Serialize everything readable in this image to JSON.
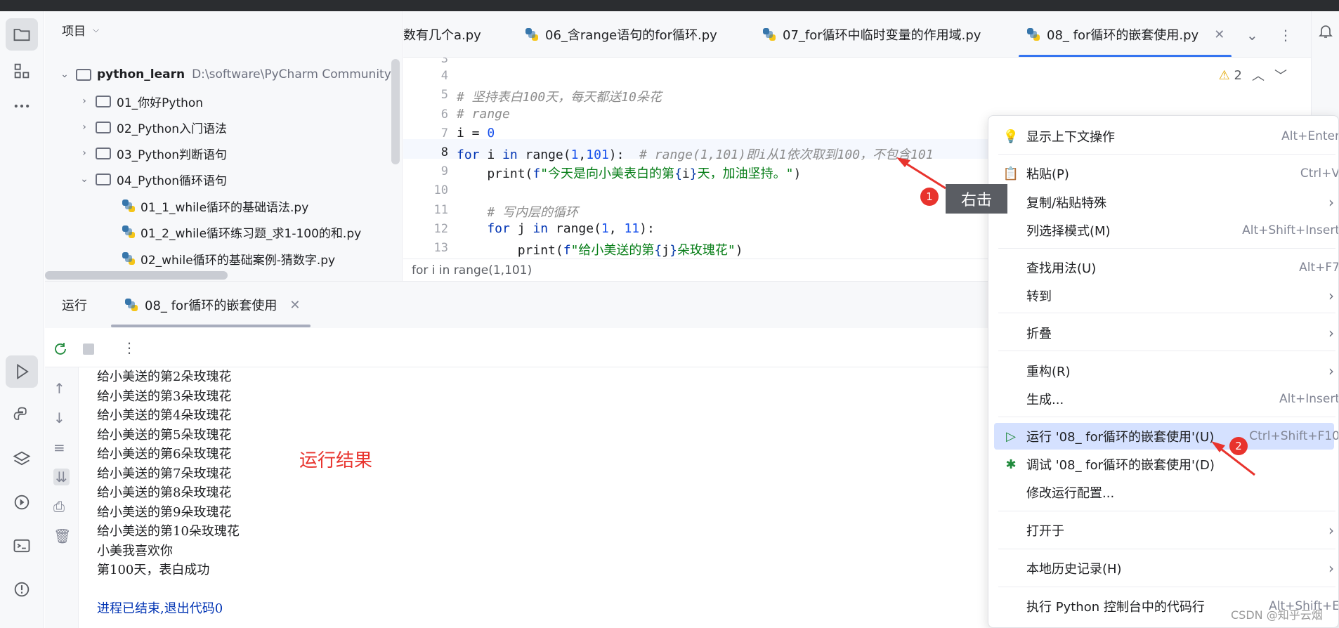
{
  "project": {
    "header": "项目",
    "tree": [
      {
        "label": "python_learn",
        "path": "D:\\software\\PyCharm Community"
      },
      {
        "label": "01_你好Python"
      },
      {
        "label": "02_Python入门语法"
      },
      {
        "label": "03_Python判断语句"
      },
      {
        "label": "04_Python循环语句"
      },
      {
        "label": "01_1_while循环的基础语法.py"
      },
      {
        "label": "01_2_while循环练习题_求1-100的和.py"
      },
      {
        "label": "02_while循环的基础案例-猜数字.py"
      }
    ]
  },
  "tabs": [
    {
      "label": "数有几个a.py"
    },
    {
      "label": "06_含range语句的for循环.py"
    },
    {
      "label": "07_for循环中临时变量的作用域.py"
    },
    {
      "label": "08_ for循环的嵌套使用.py",
      "active": true
    }
  ],
  "editor": {
    "warning_count": "2",
    "line_numbers": [
      "3",
      "4",
      "5",
      "6",
      "7",
      "8",
      "9",
      "10",
      "11",
      "12",
      "13"
    ],
    "lines": {
      "l5": "# 坚持表白100天，每天都送10朵花",
      "l6": "# range",
      "l7_a": "i = ",
      "l7_b": "0",
      "l8_kw1": "for",
      "l8_var": " i ",
      "l8_kw2": "in",
      "l8_fn": " range(",
      "l8_n1": "1",
      "l8_comma": ",",
      "l8_n2": "101",
      "l8_end": "):  ",
      "l8_cmt": "# range(1,101)即i从1依次取到100，不包含101",
      "l9_fn": "    print(",
      "l9_f": "f",
      "l9_s1": "\"今天是向小美表白的第",
      "l9_b1": "{",
      "l9_v": "i",
      "l9_b2": "}",
      "l9_s2": "天，加油坚持。\"",
      "l9_end": ")",
      "l11": "    # 写内层的循环",
      "l12_kw1": "    for",
      "l12_var": " j ",
      "l12_kw2": "in",
      "l12_fn": " range(",
      "l12_n1": "1",
      "l12_comma": ", ",
      "l12_n2": "11",
      "l12_end": "):",
      "l13_fn": "        print(",
      "l13_f": "f",
      "l13_s1": "\"给小美送的第",
      "l13_b1": "{",
      "l13_v": "j",
      "l13_b2": "}",
      "l13_s2": "朵玫瑰花\"",
      "l13_end": ")"
    },
    "breadcrumb": "for i in range(1,101)"
  },
  "run": {
    "title": "运行",
    "tab": "08_ for循环的嵌套使用",
    "output": [
      "给小美送的第2朵玫瑰花",
      "给小美送的第3朵玫瑰花",
      "给小美送的第4朵玫瑰花",
      "给小美送的第5朵玫瑰花",
      "给小美送的第6朵玫瑰花",
      "给小美送的第7朵玫瑰花",
      "给小美送的第8朵玫瑰花",
      "给小美送的第9朵玫瑰花",
      "给小美送的第10朵玫瑰花",
      "小美我喜欢你",
      "第100天，表白成功"
    ],
    "exit_message": "进程已结束,退出代码0",
    "annotation": "运行结果"
  },
  "context_menu": [
    {
      "label": "显示上下文操作",
      "shortcut": "Alt+Enter",
      "icon": "lightbulb-icon"
    },
    {
      "label": "粘贴(P)",
      "shortcut": "Ctrl+V",
      "icon": "clipboard-icon"
    },
    {
      "label": "复制/粘贴特殊",
      "submenu": true
    },
    {
      "label": "列选择模式(M)",
      "shortcut": "Alt+Shift+Insert"
    },
    {
      "label": "查找用法(U)",
      "shortcut": "Alt+F7"
    },
    {
      "label": "转到",
      "submenu": true
    },
    {
      "label": "折叠",
      "submenu": true
    },
    {
      "label": "重构(R)",
      "submenu": true
    },
    {
      "label": "生成...",
      "shortcut": "Alt+Insert"
    },
    {
      "label": "运行 '08_ for循环的嵌套使用'(U)",
      "shortcut": "Ctrl+Shift+F10",
      "icon": "run-icon",
      "highlighted": true
    },
    {
      "label": "调试 '08_ for循环的嵌套使用'(D)",
      "icon": "debug-icon"
    },
    {
      "label": "修改运行配置..."
    },
    {
      "label": "打开于",
      "submenu": true
    },
    {
      "label": "本地历史记录(H)",
      "submenu": true
    },
    {
      "label": "执行 Python 控制台中的代码行",
      "shortcut": "Alt+Shift+E"
    }
  ],
  "annotations": {
    "badge1": "1",
    "badge2": "2",
    "tooltip": "右击",
    "watermark": "CSDN @知乎云烟"
  },
  "colors": {
    "accent": "#3574f0",
    "highlight": "#d5e1ff",
    "annotation_red": "#e8332d"
  }
}
